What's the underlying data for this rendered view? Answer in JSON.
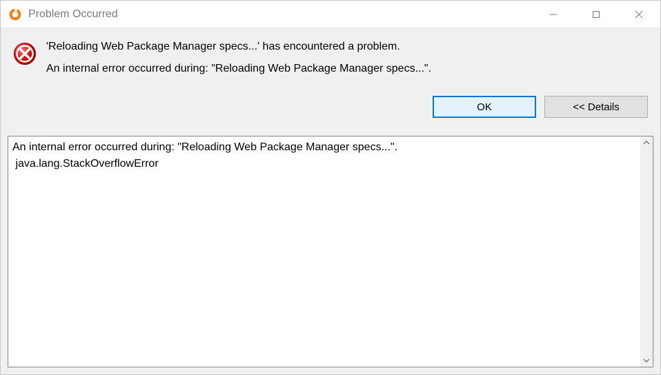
{
  "titlebar": {
    "title": "Problem Occurred"
  },
  "message": {
    "line1": "'Reloading Web Package Manager specs...' has encountered a problem.",
    "line2": "An internal error occurred during: \"Reloading Web Package Manager specs...\"."
  },
  "buttons": {
    "ok": "OK",
    "details": "<< Details"
  },
  "details": {
    "text": "An internal error occurred during: \"Reloading Web Package Manager specs...\".\n java.lang.StackOverflowError"
  }
}
